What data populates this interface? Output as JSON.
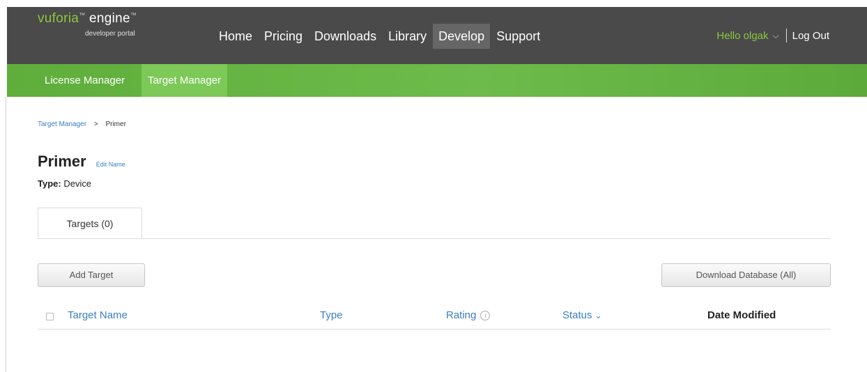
{
  "header": {
    "logo": {
      "word1": "vuforia",
      "word2": "engine",
      "tm": "™",
      "subtitle": "developer portal"
    },
    "nav": [
      {
        "label": "Home",
        "active": false
      },
      {
        "label": "Pricing",
        "active": false
      },
      {
        "label": "Downloads",
        "active": false
      },
      {
        "label": "Library",
        "active": false
      },
      {
        "label": "Develop",
        "active": true
      },
      {
        "label": "Support",
        "active": false
      }
    ],
    "user": {
      "greeting": "Hello olgak",
      "chevron": "⌵",
      "logout": "Log Out"
    }
  },
  "subnav": [
    {
      "label": "License Manager",
      "active": false
    },
    {
      "label": "Target Manager",
      "active": true
    }
  ],
  "breadcrumb": {
    "root": "Target Manager",
    "separator": ">",
    "current": "Primer"
  },
  "page": {
    "title": "Primer",
    "edit_name": "Edit Name",
    "type_label": "Type:",
    "type_value": "Device"
  },
  "tabs": [
    {
      "label": "Targets (0)",
      "active": true
    }
  ],
  "actions": {
    "add_target": "Add Target",
    "download_database": "Download Database (All)"
  },
  "table": {
    "columns": {
      "name": "Target Name",
      "type": "Type",
      "rating": "Rating",
      "status": "Status",
      "date_modified": "Date Modified"
    },
    "rating_info_icon": "i",
    "status_sort_icon": "⌄",
    "rows": []
  },
  "colors": {
    "accent_green": "#8dc63f",
    "link_blue": "#3a7fc1",
    "topbar": "#4a4a4a",
    "subnav": "#6dbb4a"
  }
}
